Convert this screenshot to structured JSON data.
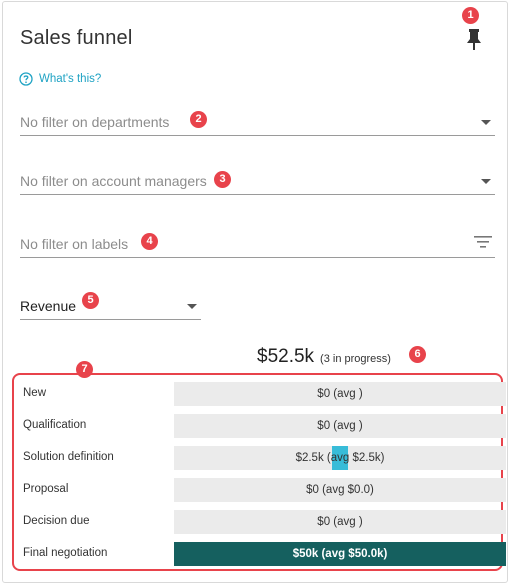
{
  "widget": {
    "title": "Sales funnel",
    "pin_icon": "pin-icon",
    "help_icon": "question-circle-icon",
    "help_link": "What's this?"
  },
  "filters": {
    "departments_placeholder": "No filter on departments",
    "account_managers_placeholder": "No filter on account managers",
    "labels_placeholder": "No filter on labels",
    "labels_icon": "filter-lines-icon"
  },
  "metric": {
    "selected": "Revenue"
  },
  "summary": {
    "total": "$52.5k",
    "in_progress": "(3 in progress)"
  },
  "badges": [
    "1",
    "2",
    "3",
    "4",
    "5",
    "6",
    "7"
  ],
  "funnel": {
    "stages": [
      {
        "label": "New",
        "value": "$0 (avg )"
      },
      {
        "label": "Qualification",
        "value": "$0 (avg )"
      },
      {
        "label": "Solution definition",
        "value": "$2.5k (avg $2.5k)",
        "fill": 0.05
      },
      {
        "label": "Proposal",
        "value": "$0 (avg $0.0)"
      },
      {
        "label": "Decision due",
        "value": "$0 (avg )"
      },
      {
        "label": "Final negotiation",
        "value": "$50k (avg $50.0k)",
        "fill": 1.0
      }
    ]
  },
  "colors": {
    "accent": "#1fa3c4",
    "badge": "#e8434b",
    "bar_bg": "#ebebeb",
    "bar_highlight": "#38bcd8",
    "bar_full": "#15605f"
  }
}
